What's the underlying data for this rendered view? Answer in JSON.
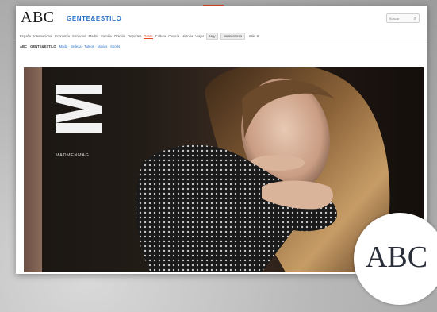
{
  "header": {
    "logo": "ABC",
    "section_title": "GENTE&ESTILO",
    "search_placeholder": "Buscar"
  },
  "nav": {
    "items": [
      "España",
      "Internacional",
      "Economía",
      "Sociedad",
      "Madrid",
      "Familia",
      "Opinión",
      "Deportes",
      "Gente",
      "Cultura",
      "Ciencia",
      "Historia",
      "Viajar"
    ],
    "active_index": 8,
    "buttons": [
      "Hoy",
      "Hemeroteca"
    ],
    "more_label": "Más"
  },
  "breadcrumb": {
    "items": [
      "ABC",
      "GENTE&ESTILO",
      "Moda · Belleza · Tuteos · Novias · Sports"
    ]
  },
  "hero": {
    "brand_wordmark": "MADMENMAG"
  },
  "badge": {
    "text": "ABC"
  },
  "colors": {
    "accent": "#e1481b",
    "link": "#2a73c9"
  }
}
